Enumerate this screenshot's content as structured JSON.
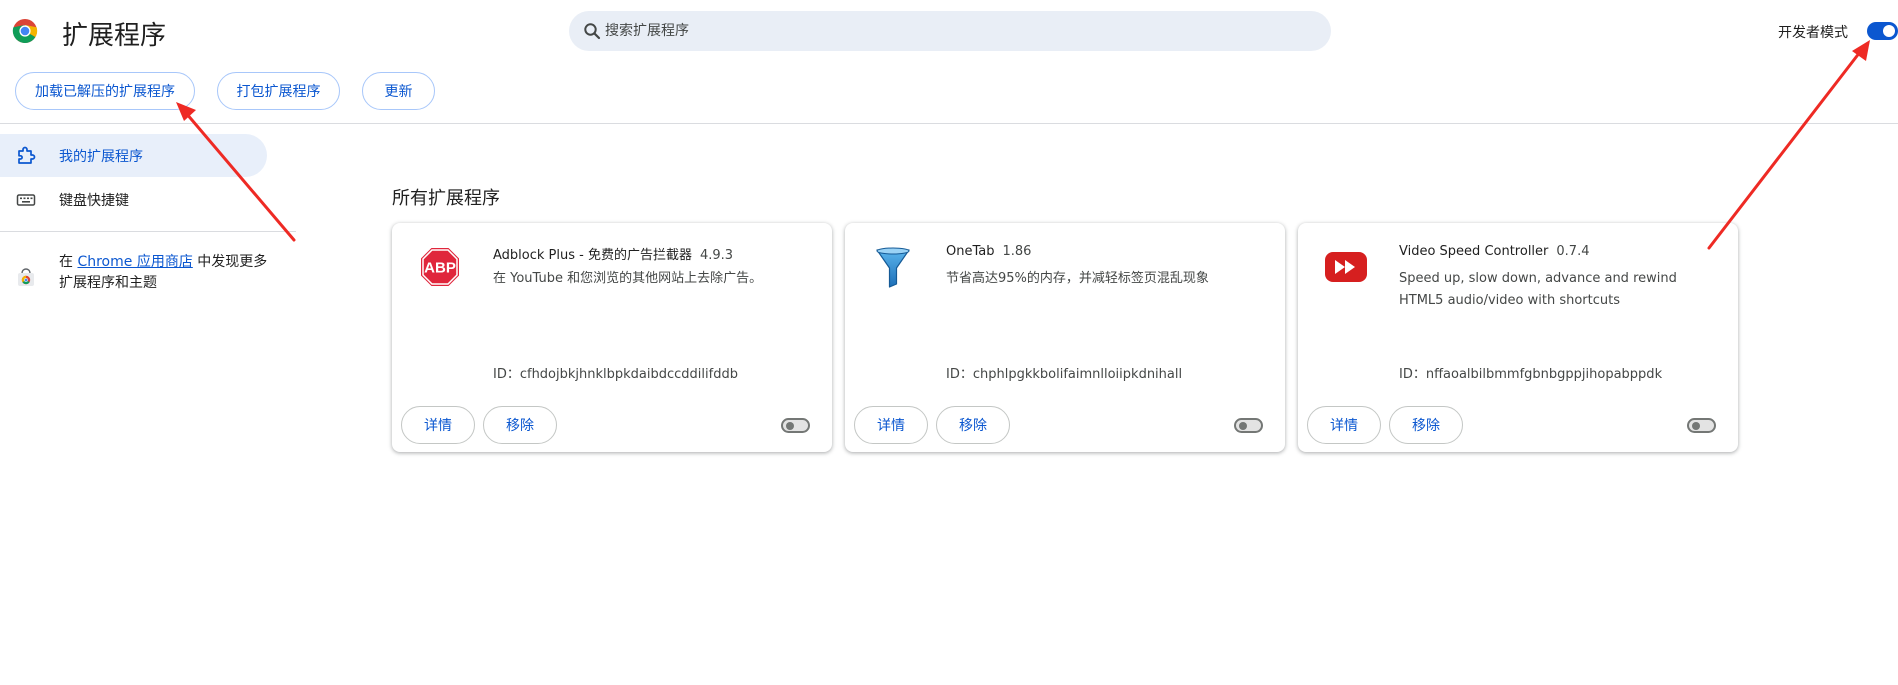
{
  "header": {
    "title": "扩展程序",
    "search_placeholder": "搜索扩展程序",
    "dev_mode_label": "开发者模式",
    "dev_mode_on": true
  },
  "toolbar": {
    "load_unpacked": "加载已解压的扩展程序",
    "pack": "打包扩展程序",
    "update": "更新"
  },
  "sidebar": {
    "items": [
      {
        "label": "我的扩展程序",
        "icon": "extension-puzzle-icon",
        "active": true
      },
      {
        "label": "键盘快捷键",
        "icon": "keyboard-icon",
        "active": false
      }
    ],
    "promo": {
      "prefix": "在 ",
      "link": "Chrome 应用商店",
      "suffix": " 中发现更多扩展程序和主题"
    }
  },
  "main": {
    "section_title": "所有扩展程序",
    "extensions": [
      {
        "name": "Adblock Plus - 免费的广告拦截器",
        "version": "4.9.3",
        "description": "在 YouTube 和您浏览的其他网站上去除广告。",
        "id": "ID：cfhdojbkjhnklbpkdaibdccddilifddb",
        "details": "详情",
        "remove": "移除",
        "enabled": false,
        "icon": "abp-stop-sign-icon",
        "icon_color": "#e0263c"
      },
      {
        "name": "OneTab",
        "version": "1.86",
        "description": "节省高达95%的内存，并减轻标签页混乱现象",
        "id": "ID：chphlpgkkbolifaimnlloiipkdnihall",
        "details": "详情",
        "remove": "移除",
        "enabled": false,
        "icon": "funnel-icon",
        "icon_color": "#1d6fb8"
      },
      {
        "name": "Video Speed Controller",
        "version": "0.7.4",
        "description": "Speed up, slow down, advance and rewind HTML5 audio/video with shortcuts",
        "id": "ID：nffaoalbilbmmfgbnbgppjihopabppdk",
        "details": "详情",
        "remove": "移除",
        "enabled": false,
        "icon": "fast-forward-icon",
        "icon_color": "#d61f1f"
      }
    ]
  },
  "colors": {
    "accent": "#0b57d0",
    "annotation_arrow": "#ee2a24"
  }
}
